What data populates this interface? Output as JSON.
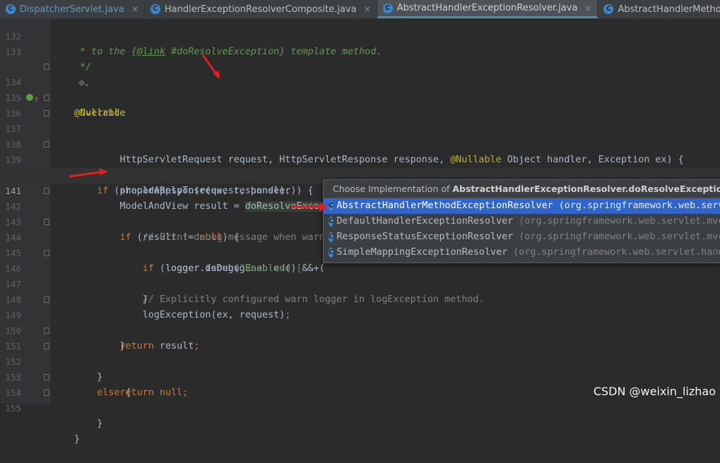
{
  "tabs": [
    {
      "label": "DispatcherServlet.java"
    },
    {
      "label": "HandlerExceptionResolverComposite.java"
    },
    {
      "label": "AbstractHandlerExceptionResolver.java"
    },
    {
      "label": "AbstractHandlerMethodExceptionResolver"
    }
  ],
  "tab_close": "×",
  "editor": {
    "current_line": "141",
    "lines": [
      {
        "n": "132"
      },
      {
        "n": "133"
      },
      {
        "n": ""
      },
      {
        "n": "134"
      },
      {
        "n": "135"
      },
      {
        "n": "136"
      },
      {
        "n": "137"
      },
      {
        "n": "138"
      },
      {
        "n": "139"
      },
      {
        "n": "140"
      },
      {
        "n": "141"
      },
      {
        "n": "142"
      },
      {
        "n": "143"
      },
      {
        "n": "144"
      },
      {
        "n": "145"
      },
      {
        "n": "146"
      },
      {
        "n": "147"
      },
      {
        "n": "148"
      },
      {
        "n": "149"
      },
      {
        "n": "150"
      },
      {
        "n": "151"
      },
      {
        "n": "152"
      },
      {
        "n": "153"
      },
      {
        "n": "154"
      },
      {
        "n": "155"
      }
    ]
  },
  "popup": {
    "title_prefix": "Choose Implementation of ",
    "title_bold": "AbstractHandlerExceptionResolver.doResolveException(HttpServ",
    "items": [
      {
        "name": "AbstractHandlerMethodExceptionResolver",
        "pkg": "(org.springframework.web.servlet.mvc",
        "selected": true
      },
      {
        "name": "DefaultHandlerExceptionResolver",
        "pkg": "(org.springframework.web.servlet.mvc.s",
        "selected": false
      },
      {
        "name": "ResponseStatusExceptionResolver",
        "pkg": "(org.springframework.web.servlet.mvc.a",
        "selected": false
      },
      {
        "name": "SimpleMappingExceptionResolver",
        "pkg": "(org.springframework.web.servlet.handle",
        "selected": false
      }
    ]
  },
  "watermark": "CSDN @weixin_lizhao",
  "colors": {
    "accent": "#2f65ca",
    "arrow": "#e02020",
    "background": "#2b2b2b"
  },
  "icons": {
    "class_icon": "c-class-icon",
    "override_icon": "override-gutter-icon"
  }
}
